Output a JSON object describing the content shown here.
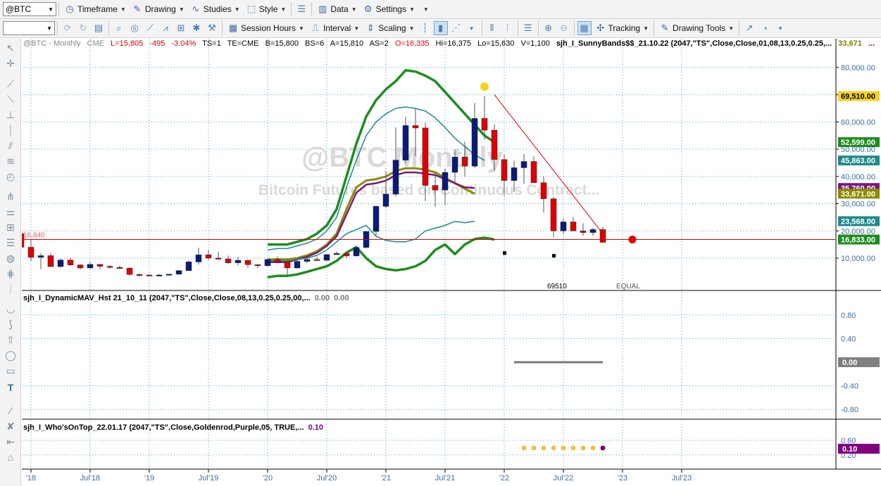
{
  "toolbar1": {
    "symbol": "@BTC",
    "timeframe": "Timeframe",
    "drawing": "Drawing",
    "studies": "Studies",
    "style": "Style",
    "data": "Data",
    "settings": "Settings"
  },
  "toolbar2": {
    "session_hours": "Session Hours",
    "interval": "Interval",
    "scaling": "Scaling",
    "tracking": "Tracking",
    "drawing_tools": "Drawing Tools"
  },
  "status": {
    "symbol": "@BTC - Monthly",
    "exchange": "CME",
    "last": "L=15,805",
    "change": "-495",
    "change_pct": "-3.04%",
    "ts": "TS=1",
    "te": "TE=CME",
    "bid": "B=15,800",
    "bid_size": "BS=6",
    "ask": "A=15,810",
    "ask_size": "AS=2",
    "open": "O=16,335",
    "high": "Hi=16,375",
    "low": "Lo=15,630",
    "volume": "V=1,100",
    "study": "sjh_I_SunnyBands$$_21.10.22 (2047,\"TS\",Close,Close,01,08,13,0.25,0.25,...",
    "study_value": "33,671",
    "study_more": "..."
  },
  "watermark": {
    "title": "@BTC Monthly",
    "subtitle": "Bitcoin Futures based on Continuous Contract..."
  },
  "price_axis": {
    "ticks": [
      "80,000.00",
      "70,000.00",
      "60,000.00",
      "50,000.00",
      "40,000.00",
      "30,000.00",
      "20,000.00",
      "10,000.00"
    ],
    "tick_values": [
      80000,
      70000,
      60000,
      50000,
      40000,
      30000,
      20000,
      10000
    ],
    "labels": [
      {
        "text": "69,510.00",
        "value": 69510,
        "color": "#f7d31a",
        "fg": "#000000"
      },
      {
        "text": "52,599.00",
        "value": 52599,
        "color": "#1e8c1e",
        "fg": "#ffffff"
      },
      {
        "text": "45,863.00",
        "value": 45863,
        "color": "#1f8a8a",
        "fg": "#ffffff"
      },
      {
        "text": "35,760.00",
        "value": 35760,
        "color": "#7a1a7a",
        "fg": "#ffffff"
      },
      {
        "text": "33,671.00",
        "value": 33671,
        "color": "#8b8b00",
        "fg": "#ffffff"
      },
      {
        "text": "23,568.00",
        "value": 23568,
        "color": "#1f8a8a",
        "fg": "#ffffff"
      },
      {
        "text": "16,833.00",
        "value": 16833,
        "color": "#1e8c1e",
        "fg": "#ffffff"
      }
    ]
  },
  "price_annotations": {
    "left_label": "16,840",
    "high_label": "69510",
    "equal_label": "EQUAL"
  },
  "pane2": {
    "title": "sjh_I_DynamicMAV_Hst 21_10_11 (2047,\"TS\",Close,Close,08,13,0.25,0.25,00,...",
    "v1": "0.00",
    "v2": "0.00",
    "ticks": [
      "0.80",
      "0.40",
      "-0.40",
      "-0.80"
    ],
    "tick_values": [
      0.8,
      0.4,
      -0.4,
      -0.8
    ],
    "current_label": "0.00",
    "current_value": 0
  },
  "pane3": {
    "title": "sjh_I_Who'sOnTop_22.01.17 (2047,\"TS\",Close,Goldenrod,Purple,05, TRUE,...",
    "v1": "0.10",
    "ticks": [
      "0.60",
      "0.20"
    ],
    "tick_values": [
      0.6,
      0.2
    ],
    "current_label": "0.10",
    "current_value": 0.1,
    "dots": [
      "goldenrod",
      "goldenrod",
      "goldenrod",
      "goldenrod",
      "goldenrod",
      "goldenrod",
      "goldenrod",
      "goldenrod",
      "purple"
    ]
  },
  "time_axis": {
    "labels": [
      "'18",
      "Jul'18",
      "'19",
      "Jul'19",
      "'20",
      "Jul'20",
      "'21",
      "Jul'21",
      "'22",
      "Jul'22",
      "'23",
      "Jul'23"
    ]
  },
  "colors": {
    "up_candle": "#0a1a7a",
    "down_candle": "#e00000",
    "band_outer": "#1e8c1e",
    "band_inner": "#1f8a8a",
    "mav_gold": "#8b8b00",
    "mav_purple": "#7a1a7a",
    "last_price_line": "#e00000",
    "grid": "#3fa0e0"
  },
  "chart_data": {
    "type": "candlestick",
    "title": "@BTC - Monthly",
    "x": [
      "2017-12",
      "2018-01",
      "2018-02",
      "2018-03",
      "2018-04",
      "2018-05",
      "2018-06",
      "2018-07",
      "2018-08",
      "2018-09",
      "2018-10",
      "2018-11",
      "2018-12",
      "2019-01",
      "2019-02",
      "2019-03",
      "2019-04",
      "2019-05",
      "2019-06",
      "2019-07",
      "2019-08",
      "2019-09",
      "2019-10",
      "2019-11",
      "2019-12",
      "2020-01",
      "2020-02",
      "2020-03",
      "2020-04",
      "2020-05",
      "2020-06",
      "2020-07",
      "2020-08",
      "2020-09",
      "2020-10",
      "2020-11",
      "2020-12",
      "2021-01",
      "2021-02",
      "2021-03",
      "2021-04",
      "2021-05",
      "2021-06",
      "2021-07",
      "2021-08",
      "2021-09",
      "2021-10",
      "2021-11",
      "2021-12",
      "2022-01",
      "2022-02",
      "2022-03",
      "2022-04",
      "2022-05",
      "2022-06",
      "2022-07",
      "2022-08",
      "2022-09",
      "2022-10",
      "2022-11"
    ],
    "open": [
      19000,
      14000,
      10300,
      10900,
      6900,
      9300,
      7500,
      6400,
      7700,
      7000,
      6600,
      6300,
      4000,
      3800,
      3500,
      3800,
      4100,
      5400,
      8600,
      11200,
      10000,
      9700,
      8300,
      9200,
      7600,
      7200,
      9500,
      8600,
      6400,
      8800,
      9500,
      9200,
      11300,
      11700,
      10800,
      13900,
      19800,
      29000,
      33500,
      46000,
      58700,
      57800,
      36700,
      35000,
      41500,
      47100,
      43800,
      61300,
      57000,
      46200,
      38500,
      43200,
      45500,
      37700,
      31800,
      20000,
      23300,
      20000,
      19400,
      20500
    ],
    "high": [
      25000,
      17000,
      11800,
      11800,
      9800,
      10000,
      7800,
      8500,
      7800,
      7400,
      7200,
      6600,
      4400,
      4100,
      4200,
      4200,
      5600,
      9100,
      13800,
      13000,
      12300,
      10900,
      10500,
      9400,
      7700,
      9600,
      10600,
      9300,
      9500,
      10100,
      10500,
      11500,
      12500,
      12100,
      14000,
      19900,
      29400,
      41900,
      58000,
      61900,
      64900,
      59700,
      41400,
      42800,
      50000,
      52800,
      67000,
      69510,
      59100,
      48000,
      45800,
      48200,
      47400,
      40000,
      32400,
      24600,
      25100,
      22800,
      21100,
      21500
    ],
    "low": [
      11500,
      9000,
      6000,
      6700,
      6500,
      7100,
      5800,
      6100,
      5900,
      6100,
      6100,
      3500,
      3200,
      3400,
      3400,
      3800,
      4100,
      5400,
      7600,
      9300,
      9400,
      7800,
      7300,
      6500,
      6400,
      7000,
      8500,
      3900,
      6200,
      8300,
      9000,
      9100,
      11200,
      10000,
      10600,
      13500,
      18100,
      28400,
      32600,
      45000,
      47500,
      31000,
      29000,
      29600,
      37400,
      40000,
      43200,
      53500,
      42000,
      32900,
      34300,
      37200,
      37700,
      26800,
      17600,
      18800,
      19900,
      18200,
      18200,
      15630
    ],
    "close": [
      14000,
      10300,
      10900,
      6900,
      9300,
      7500,
      6400,
      7700,
      7000,
      6600,
      6300,
      4000,
      3800,
      3500,
      3800,
      4100,
      5400,
      8600,
      11200,
      10000,
      9700,
      8300,
      9200,
      7600,
      7200,
      9500,
      8600,
      6400,
      8800,
      9500,
      9200,
      11300,
      11700,
      10800,
      13900,
      19800,
      29000,
      33500,
      46000,
      58700,
      57800,
      36700,
      35000,
      41500,
      47100,
      43800,
      61300,
      57000,
      46200,
      38500,
      43200,
      45500,
      37700,
      31800,
      20000,
      23300,
      20000,
      19400,
      20500,
      15805
    ],
    "bands": {
      "outer_upper": {
        "start": "2020-01",
        "values": [
          15000,
          15000,
          15000,
          16000,
          17000,
          19000,
          22000,
          28000,
          40000,
          52000,
          62000,
          68000,
          72000,
          75000,
          79000,
          78500,
          77000,
          75000,
          71000,
          67000,
          63000,
          59000,
          55000,
          52599
        ]
      },
      "inner_upper": {
        "start": "2020-01",
        "values": [
          13000,
          13500,
          13500,
          14500,
          15500,
          17000,
          20000,
          25000,
          36000,
          46000,
          55000,
          60000,
          63000,
          65000,
          65500,
          65000,
          64000,
          61500,
          58000,
          54000,
          51000,
          48000,
          45863
        ]
      },
      "mav_gold": {
        "start": "2020-01",
        "values": [
          9500,
          9500,
          9500,
          10000,
          11000,
          12500,
          15000,
          19000,
          28000,
          36000,
          38500,
          39000,
          40000,
          42000,
          43000,
          43000,
          42500,
          41500,
          39500,
          37500,
          35500,
          33671
        ]
      },
      "mav_purple": {
        "start": "2020-01",
        "values": [
          8500,
          8500,
          8500,
          9500,
          10500,
          12000,
          14500,
          18000,
          26000,
          34000,
          37000,
          37500,
          38500,
          40500,
          41500,
          41500,
          41000,
          40500,
          39000,
          37500,
          36000,
          35760
        ]
      },
      "inner_lower": {
        "start": "2020-01",
        "values": [
          9000,
          9000,
          9000,
          9500,
          10000,
          11000,
          13000,
          16000,
          19000,
          20500,
          22000,
          18000,
          16500,
          16000,
          16000,
          17000,
          20000,
          21000,
          22000,
          23500,
          23000,
          23568
        ]
      },
      "outer_lower": {
        "start": "2020-01",
        "values": [
          3000,
          3500,
          3500,
          4000,
          5000,
          6000,
          7000,
          9000,
          12000,
          14000,
          10000,
          7000,
          6000,
          5500,
          6000,
          7000,
          9000,
          13000,
          15000,
          11500,
          15000,
          17000,
          17500,
          16833
        ]
      }
    },
    "yrange": [
      0,
      90000
    ],
    "last_price": 16833
  }
}
